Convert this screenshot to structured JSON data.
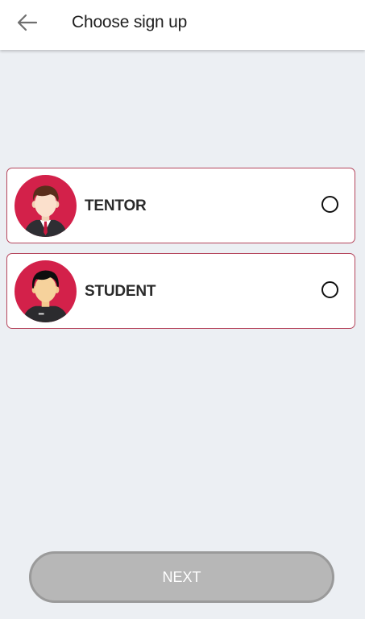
{
  "header": {
    "title": "Choose sign up",
    "back_icon": "arrow-left-icon"
  },
  "options": [
    {
      "label": "TENTOR",
      "avatar_icon": "teacher-avatar-icon",
      "selected": false
    },
    {
      "label": "STUDENT",
      "avatar_icon": "student-avatar-icon",
      "selected": false
    }
  ],
  "footer": {
    "next_label": "NEXT"
  },
  "colors": {
    "background": "#eceff3",
    "card_border": "#b5455c",
    "avatar_bg": "#d3214a",
    "button_bg": "#b7b7b7",
    "button_text": "#ffffff"
  }
}
